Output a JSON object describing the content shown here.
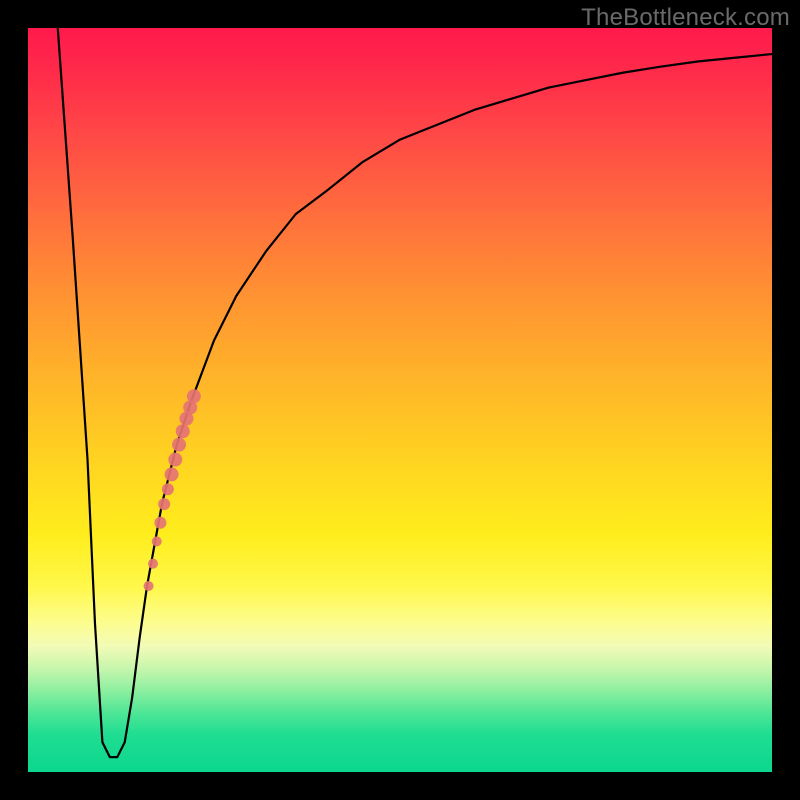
{
  "watermark": "TheBottleneck.com",
  "chart_data": {
    "type": "line",
    "title": "",
    "xlabel": "",
    "ylabel": "",
    "xlim": [
      0,
      100
    ],
    "ylim": [
      0,
      100
    ],
    "series": [
      {
        "name": "bottleneck-curve",
        "x": [
          4,
          6,
          8,
          9,
          10,
          11,
          12,
          13,
          14,
          15,
          16,
          18,
          20,
          22,
          25,
          28,
          32,
          36,
          40,
          45,
          50,
          55,
          60,
          65,
          70,
          75,
          80,
          85,
          90,
          95,
          100
        ],
        "values": [
          100,
          72,
          42,
          20,
          4,
          2,
          2,
          4,
          10,
          18,
          25,
          36,
          44,
          50,
          58,
          64,
          70,
          75,
          78,
          82,
          85,
          87,
          89,
          90.5,
          92,
          93,
          94,
          94.8,
          95.5,
          96,
          96.5
        ]
      }
    ],
    "markers": {
      "name": "highlighted-range",
      "color": "#e57373",
      "points": [
        {
          "x": 16.2,
          "y": 25,
          "r": 5
        },
        {
          "x": 16.8,
          "y": 28,
          "r": 5
        },
        {
          "x": 17.3,
          "y": 31,
          "r": 5
        },
        {
          "x": 17.8,
          "y": 33.5,
          "r": 6
        },
        {
          "x": 18.3,
          "y": 36,
          "r": 6
        },
        {
          "x": 18.8,
          "y": 38,
          "r": 6
        },
        {
          "x": 19.3,
          "y": 40,
          "r": 7
        },
        {
          "x": 19.8,
          "y": 42,
          "r": 7
        },
        {
          "x": 20.3,
          "y": 44,
          "r": 7
        },
        {
          "x": 20.8,
          "y": 45.8,
          "r": 7
        },
        {
          "x": 21.3,
          "y": 47.5,
          "r": 7
        },
        {
          "x": 21.8,
          "y": 49,
          "r": 7
        },
        {
          "x": 22.3,
          "y": 50.5,
          "r": 7
        }
      ]
    },
    "gradient_stops": [
      {
        "pct": 0,
        "color": "#ff1a4d"
      },
      {
        "pct": 14,
        "color": "#ff4747"
      },
      {
        "pct": 34,
        "color": "#ff8c34"
      },
      {
        "pct": 58,
        "color": "#ffd321"
      },
      {
        "pct": 80,
        "color": "#fdfd8f"
      },
      {
        "pct": 100,
        "color": "#0cd78e"
      }
    ]
  }
}
